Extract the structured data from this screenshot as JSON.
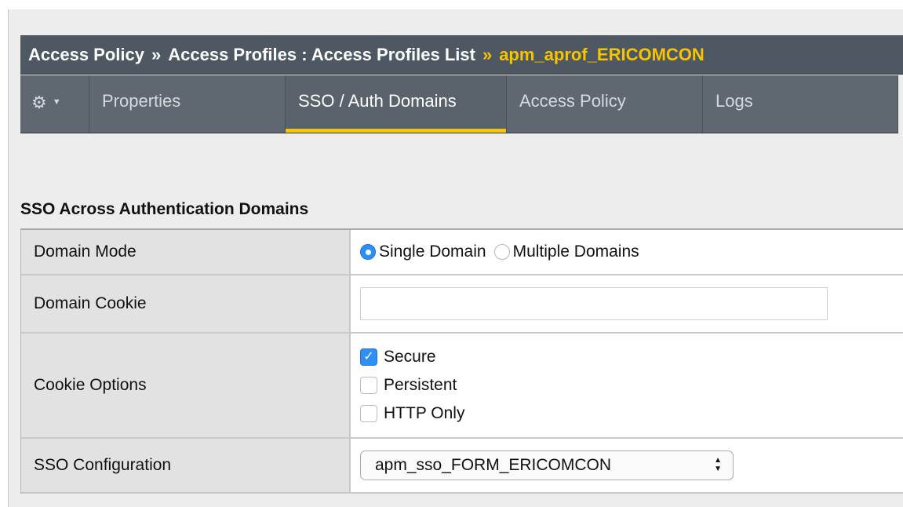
{
  "breadcrumb": {
    "item1": "Access Policy",
    "sep": "»",
    "item2": "Access Profiles : Access Profiles List",
    "current": "apm_aprof_ERICOMCON"
  },
  "tabs": [
    {
      "label": "Properties",
      "active": false
    },
    {
      "label": "SSO / Auth Domains",
      "active": true
    },
    {
      "label": "Access Policy",
      "active": false
    },
    {
      "label": "Logs",
      "active": false
    }
  ],
  "icons": {
    "gear": "gear-icon",
    "caret": "caret-down-icon"
  },
  "section": {
    "title": "SSO Across Authentication Domains"
  },
  "form": {
    "domain_mode": {
      "label": "Domain Mode",
      "options": [
        "Single Domain",
        "Multiple Domains"
      ],
      "selected": "Single Domain"
    },
    "domain_cookie": {
      "label": "Domain Cookie",
      "value": ""
    },
    "cookie_options": {
      "label": "Cookie Options",
      "options": [
        {
          "label": "Secure",
          "checked": true
        },
        {
          "label": "Persistent",
          "checked": false
        },
        {
          "label": "HTTP Only",
          "checked": false
        }
      ]
    },
    "sso_configuration": {
      "label": "SSO Configuration",
      "value": "apm_sso_FORM_ERICOMCON"
    }
  },
  "colors": {
    "accent": "#f7c400",
    "header_bg": "#4e5863",
    "tab_bg": "#5f6870",
    "check_blue": "#2e8ff5"
  }
}
